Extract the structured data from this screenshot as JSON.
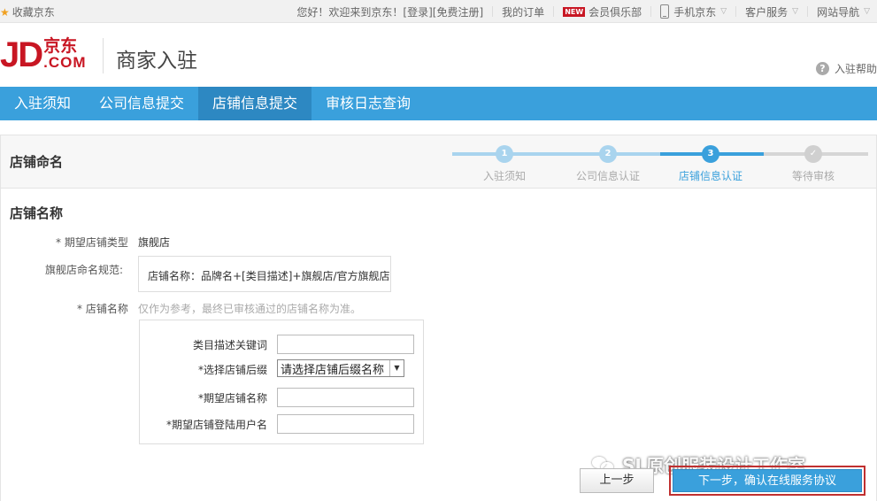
{
  "topbar": {
    "favorite": "收藏京东",
    "welcome": "您好！欢迎来到京东！",
    "login": "[登录]",
    "register": "[免费注册]",
    "my_orders": "我的订单",
    "new_badge": "NEW",
    "club": "会员俱乐部",
    "mobile": "手机京东",
    "service": "客户服务",
    "site_nav": "网站导航"
  },
  "header": {
    "logo_jd": "JD",
    "logo_cn": "京东",
    "logo_com": ".COM",
    "title": "商家入驻",
    "help": "入驻帮助"
  },
  "nav": {
    "items": [
      "入驻须知",
      "公司信息提交",
      "店铺信息提交",
      "审核日志查询"
    ],
    "active_index": 2
  },
  "panel": {
    "title": "店铺命名",
    "steps": [
      {
        "num": "1",
        "label": "入驻须知",
        "state": "done"
      },
      {
        "num": "2",
        "label": "公司信息认证",
        "state": "done"
      },
      {
        "num": "3",
        "label": "店铺信息认证",
        "state": "current"
      },
      {
        "num": "✓",
        "label": "等待审核",
        "state": "todo"
      }
    ],
    "colors": {
      "done": "#a9d4ee",
      "current": "#3aa0dc",
      "todo": "#d0d0d0"
    }
  },
  "form": {
    "section_title": "店铺名称",
    "store_type_label": "* 期望店铺类型",
    "store_type_value": "旗舰店",
    "rule_label": "旗舰店命名规范:",
    "rule_text": "店铺名称：品牌名+[类目描述]+旗舰店/官方旗舰店",
    "name_label": "* 店铺名称",
    "hint": "仅作为参考，最终已审核通过的店铺名称为准。",
    "category_label": "类目描述关键词",
    "category_value": "",
    "suffix_label": "*选择店铺后缀",
    "suffix_value": "请选择店铺后缀名称",
    "expected_name_label": "*期望店铺名称",
    "expected_name_value": "",
    "login_name_label": "*期望店铺登陆用户名",
    "login_name_value": ""
  },
  "watermark": "SL原创服装设计工作室",
  "buttons": {
    "prev": "上一步",
    "next": "下一步，确认在线服务协议"
  }
}
